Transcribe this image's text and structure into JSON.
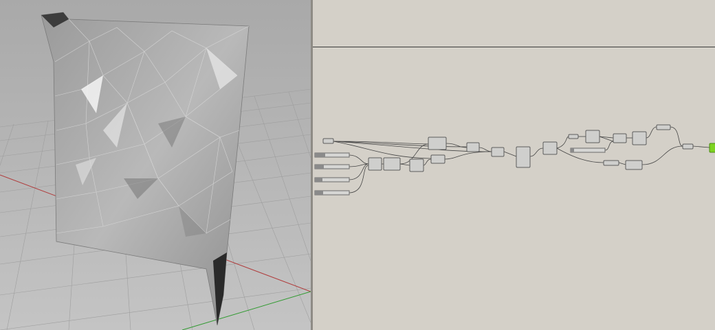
{
  "colors": {
    "viewport_background": "#b5b5b5",
    "grid_line": "#9c9c9c",
    "x_axis": "#b03a3a",
    "y_axis": "#2f9a2f",
    "canvas_background": "#d4d0c8",
    "component_fill": "#cfcfcd",
    "output_node": "#7ed321"
  },
  "viewport": {
    "name": "rhino-perspective-viewport",
    "object": "faceted-surface-mesh"
  },
  "canvas": {
    "name": "grasshopper-canvas"
  }
}
